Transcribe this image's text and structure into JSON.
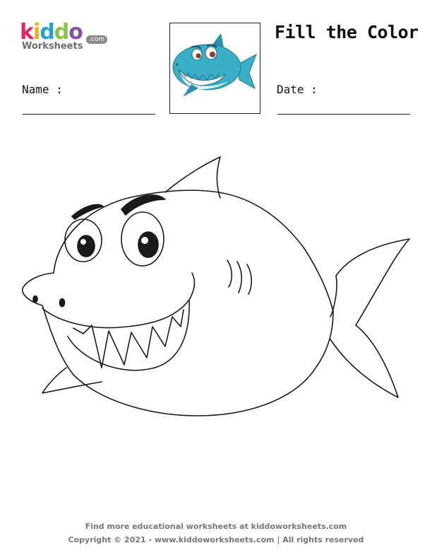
{
  "logo": {
    "letters": [
      {
        "char": "k",
        "color": "#e5245f"
      },
      {
        "char": "i",
        "color": "#f7a81b"
      },
      {
        "char": "d",
        "color": "#2a9fd8"
      },
      {
        "char": "d",
        "color": "#8ac43f"
      },
      {
        "char": "o",
        "color": "#8b4fa8"
      }
    ],
    "sub": "Worksheets",
    "com": ".com"
  },
  "header": {
    "title": "Fill the Color",
    "name_label": "Name :",
    "date_label": "Date :"
  },
  "thumbnail": {
    "icon": "shark-icon",
    "colors": {
      "body": "#3aaec6",
      "belly": "#e4f4f4"
    }
  },
  "illustration": {
    "icon": "shark-outline-icon"
  },
  "footer": {
    "line1": "Find more educational worksheets at kiddoworksheets.com",
    "line2": "Copyright © 2021 - www.kiddoworksheets.com  |  All rights reserved"
  }
}
